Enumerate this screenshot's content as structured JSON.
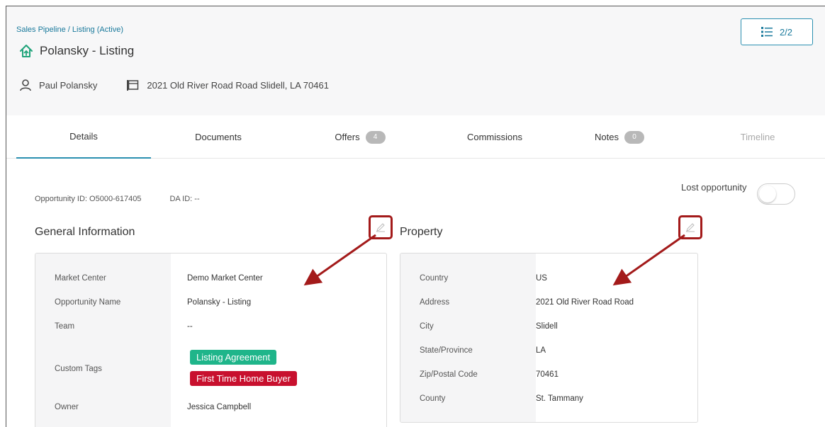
{
  "header": {
    "breadcrumb": "Sales Pipeline / Listing (Active)",
    "title": "Polansky - Listing",
    "contact_name": "Paul Polansky",
    "address": "2021 Old River Road Road Slidell, LA 70461",
    "pager": "2/2"
  },
  "tabs": [
    {
      "label": "Details",
      "active": true
    },
    {
      "label": "Documents"
    },
    {
      "label": "Offers",
      "badge": "4"
    },
    {
      "label": "Commissions"
    },
    {
      "label": "Notes",
      "badge": "0"
    },
    {
      "label": "Timeline",
      "disabled": true
    }
  ],
  "ids": {
    "opportunity": "Opportunity ID:  O5000-617405",
    "da": "DA ID:  --"
  },
  "lost_label": "Lost opportunity",
  "general": {
    "title": "General Information",
    "labels": [
      "Market Center",
      "Opportunity Name",
      "Team",
      "Custom Tags",
      "Owner"
    ],
    "values": [
      "Demo Market Center",
      "Polansky - Listing",
      "--",
      "",
      "Jessica Campbell"
    ],
    "tags": [
      {
        "label": "Listing Agreement",
        "color": "#1fb58a"
      },
      {
        "label": "First Time Home Buyer",
        "color": "#c8102e"
      }
    ]
  },
  "property": {
    "title": "Property",
    "labels": [
      "Country",
      "Address",
      "City",
      "State/Province",
      "Zip/Postal Code",
      "County"
    ],
    "values": [
      "US",
      "2021 Old River Road Road",
      "Slidell",
      "LA",
      "70461",
      "St. Tammany"
    ]
  },
  "colors": {
    "accent": "#2a8fb0",
    "link": "#1a7a9c",
    "annotation": "#a31a1a",
    "house_icon": "#1fa37a"
  }
}
